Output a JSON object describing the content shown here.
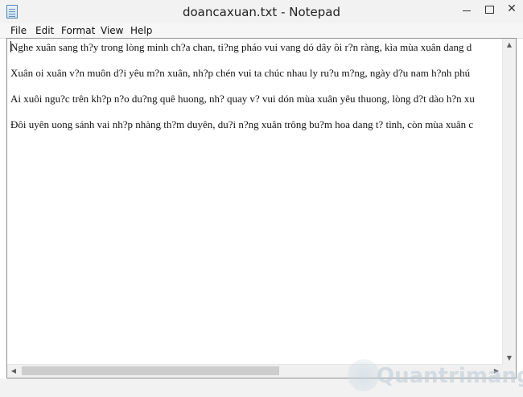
{
  "window": {
    "title": "doancaxuan.txt - Notepad",
    "controls": {
      "minimize": "",
      "maximize": "",
      "close": "✕"
    }
  },
  "menu": {
    "items": [
      "File",
      "Edit",
      "Format",
      "View",
      "Help"
    ]
  },
  "document": {
    "lines": [
      "Nghe xuân sang th?y trong lòng minh ch?a chan, ti?ng pháo vui vang dó dây ôi r?n ràng, kìa mùa xuân dang d",
      "Xuân oi xuân v?n muôn d?i yêu m?n xuân, nh?p chén vui ta chúc nhau ly ru?u m?ng, ngày d?u nam h?nh phú",
      "Ai xuôi ngu?c trên kh?p n?o du?ng quê huong, nh? quay v? vui dón mùa xuân yêu thuong, lòng d?t dào h?n xu",
      "Đôi uyên uong sánh vai nh?p nhàng th?m duyên, du?i n?ng xuân trông bu?m hoa dang t? tình, còn mùa xuân c"
    ]
  },
  "scrollbars": {
    "up": "▲",
    "down": "▼",
    "left": "◀",
    "right": "▶"
  },
  "watermark": {
    "text": "Quantrimang"
  }
}
